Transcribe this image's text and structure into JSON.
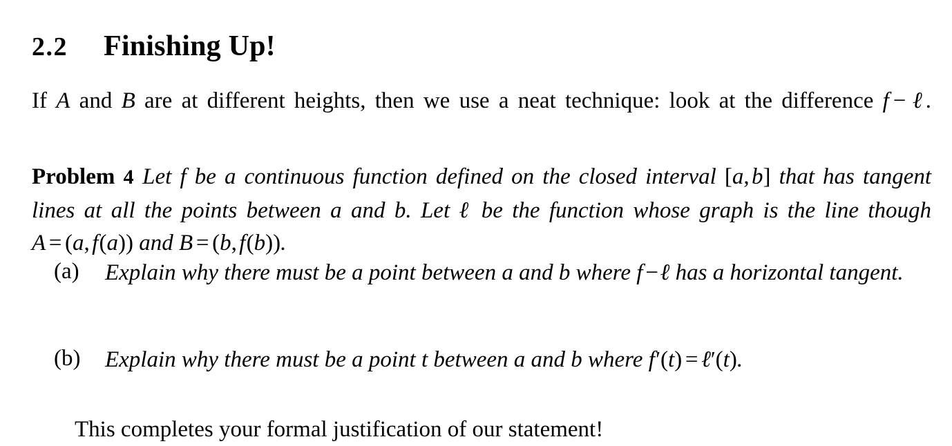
{
  "document": {
    "section": {
      "number": "2.2",
      "title": "Finishing Up!"
    },
    "intro_paragraph": {
      "part1": "If ",
      "var_a": "A",
      "part2": " and ",
      "var_b": "B",
      "part3": " are at different heights, then we use a neat technique: look at the difference ",
      "math_f": "f",
      "math_minus": "−",
      "math_ell": "ℓ",
      "part4": "."
    },
    "problem": {
      "label": "Problem",
      "number": "4",
      "text_1": "Let ",
      "var_f": "f",
      "text_2": " be a continuous function defined on the closed interval ",
      "interval_open": "[",
      "interval_a": "a",
      "interval_comma": ",",
      "interval_b": "b",
      "interval_close": "]",
      "text_3": " that has tangent lines at all the points between ",
      "var_a2": "a",
      "text_4": " and ",
      "var_b2": "b",
      "text_5": ". Let ",
      "var_ell": "ℓ",
      "text_6": " be the function whose graph is the line though ",
      "var_A": "A",
      "eq1": "=",
      "pt_a_open": "(",
      "pt_a": "a",
      "pt_a_comma": ",",
      "pt_fa": "f",
      "pt_fa_open": "(",
      "pt_fa_arg": "a",
      "pt_fa_close": ")",
      "pt_a_close": ")",
      "text_7": " and ",
      "var_B": "B",
      "eq2": "=",
      "pt_b_open": "(",
      "pt_b": "b",
      "pt_b_comma": ",",
      "pt_fb": "f",
      "pt_fb_open": "(",
      "pt_fb_arg": "b",
      "pt_fb_close": ")",
      "pt_b_close": ")",
      "text_8": "."
    },
    "list": [
      {
        "marker": "(a)",
        "text_1": "Explain why there must be a point between ",
        "var_a": "a",
        "text_2": " and ",
        "var_b": "b",
        "text_3": " where ",
        "math_f": "f",
        "math_minus": "−",
        "math_ell": "ℓ",
        "text_4": " has a horizontal tangent."
      },
      {
        "marker": "(b)",
        "text_1": "Explain why there must be a point ",
        "var_t": "t",
        "text_2": " between ",
        "var_a": "a",
        "text_3": " and ",
        "var_b": "b",
        "text_4": " where ",
        "eq_f": "f",
        "eq_f_prime": "′",
        "eq_f_open": "(",
        "eq_f_arg": "t",
        "eq_f_close": ")",
        "eq_sign": "=",
        "eq_ell": "ℓ",
        "eq_ell_prime": "′",
        "eq_ell_open": "(",
        "eq_ell_arg": "t",
        "eq_ell_close": ")",
        "text_5": "."
      }
    ],
    "closing": "This completes your formal justification of our statement!"
  }
}
